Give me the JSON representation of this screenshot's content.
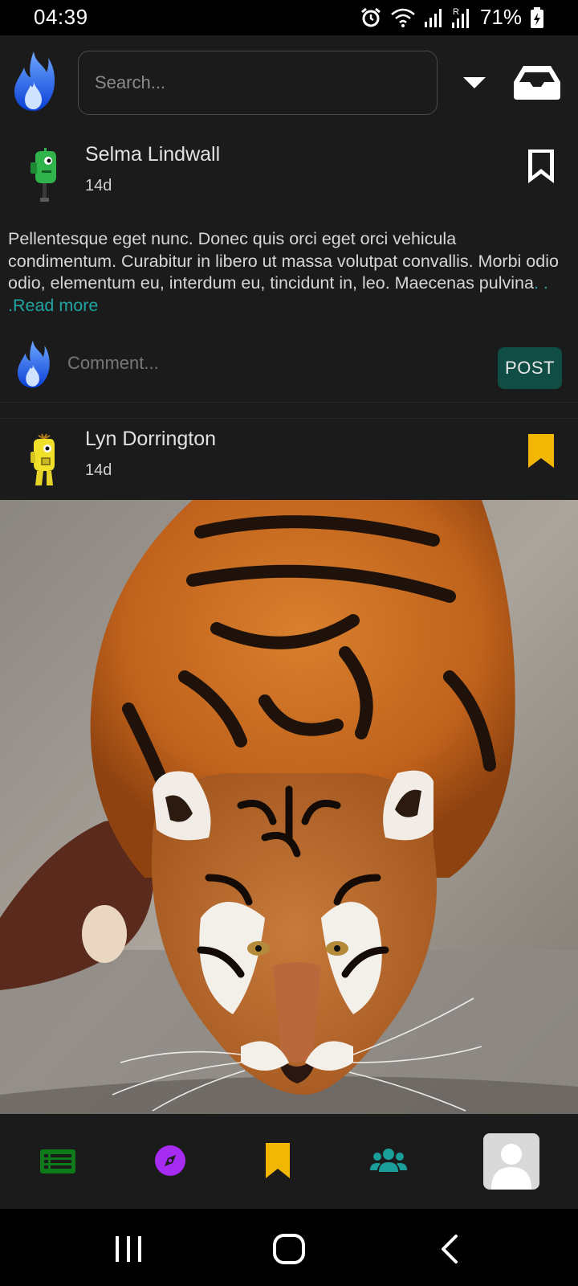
{
  "status_bar": {
    "time": "04:39",
    "battery": "71%",
    "icons": [
      "alarm-icon",
      "wifi-icon",
      "signal-icon",
      "signal-roaming-icon",
      "battery-charging-icon"
    ]
  },
  "app_bar": {
    "logo": "flame-logo",
    "search": {
      "placeholder": "Search...",
      "value": ""
    },
    "dropdown_icon": "caret-down-icon",
    "inbox_icon": "inbox-icon"
  },
  "feed": {
    "posts": [
      {
        "author": "Selma Lindwall",
        "age": "14d",
        "avatar": "green-robot-avatar",
        "bookmarked": false,
        "body": "Pellentesque eget nunc. Donec quis orci eget orci vehicula condimentum. Curabitur in libero ut massa volutpat convallis. Morbi odio odio, elementum eu, interdum eu, tincidunt in, leo. Maecenas pulvina",
        "ellipsis": ". . .",
        "read_more": "Read more",
        "comment": {
          "placeholder": "Comment...",
          "value": "",
          "post_label": "POST"
        }
      },
      {
        "author": "Lyn Dorrington",
        "age": "14d",
        "avatar": "yellow-robot-avatar",
        "bookmarked": true,
        "image": "tiger-photo"
      }
    ]
  },
  "bottom_nav": {
    "items": [
      {
        "name": "feed",
        "icon": "list-icon",
        "color": "#0d7a1a"
      },
      {
        "name": "explore",
        "icon": "compass-icon",
        "color": "#a52cf0"
      },
      {
        "name": "saved",
        "icon": "bookmark-icon",
        "color": "#f2b705"
      },
      {
        "name": "groups",
        "icon": "people-icon",
        "color": "#1b9e9a"
      },
      {
        "name": "profile",
        "icon": "profile-avatar-icon",
        "color": "#d9d9d9"
      }
    ]
  },
  "system_nav": {
    "icons": [
      "recent-apps-icon",
      "home-icon",
      "back-icon"
    ]
  },
  "colors": {
    "background": "#1b1b1b",
    "accent_teal": "#20a5a0",
    "post_button": "#0f4d45",
    "bookmark_active": "#f2b705",
    "bookmark_inactive": "#ffffff"
  }
}
